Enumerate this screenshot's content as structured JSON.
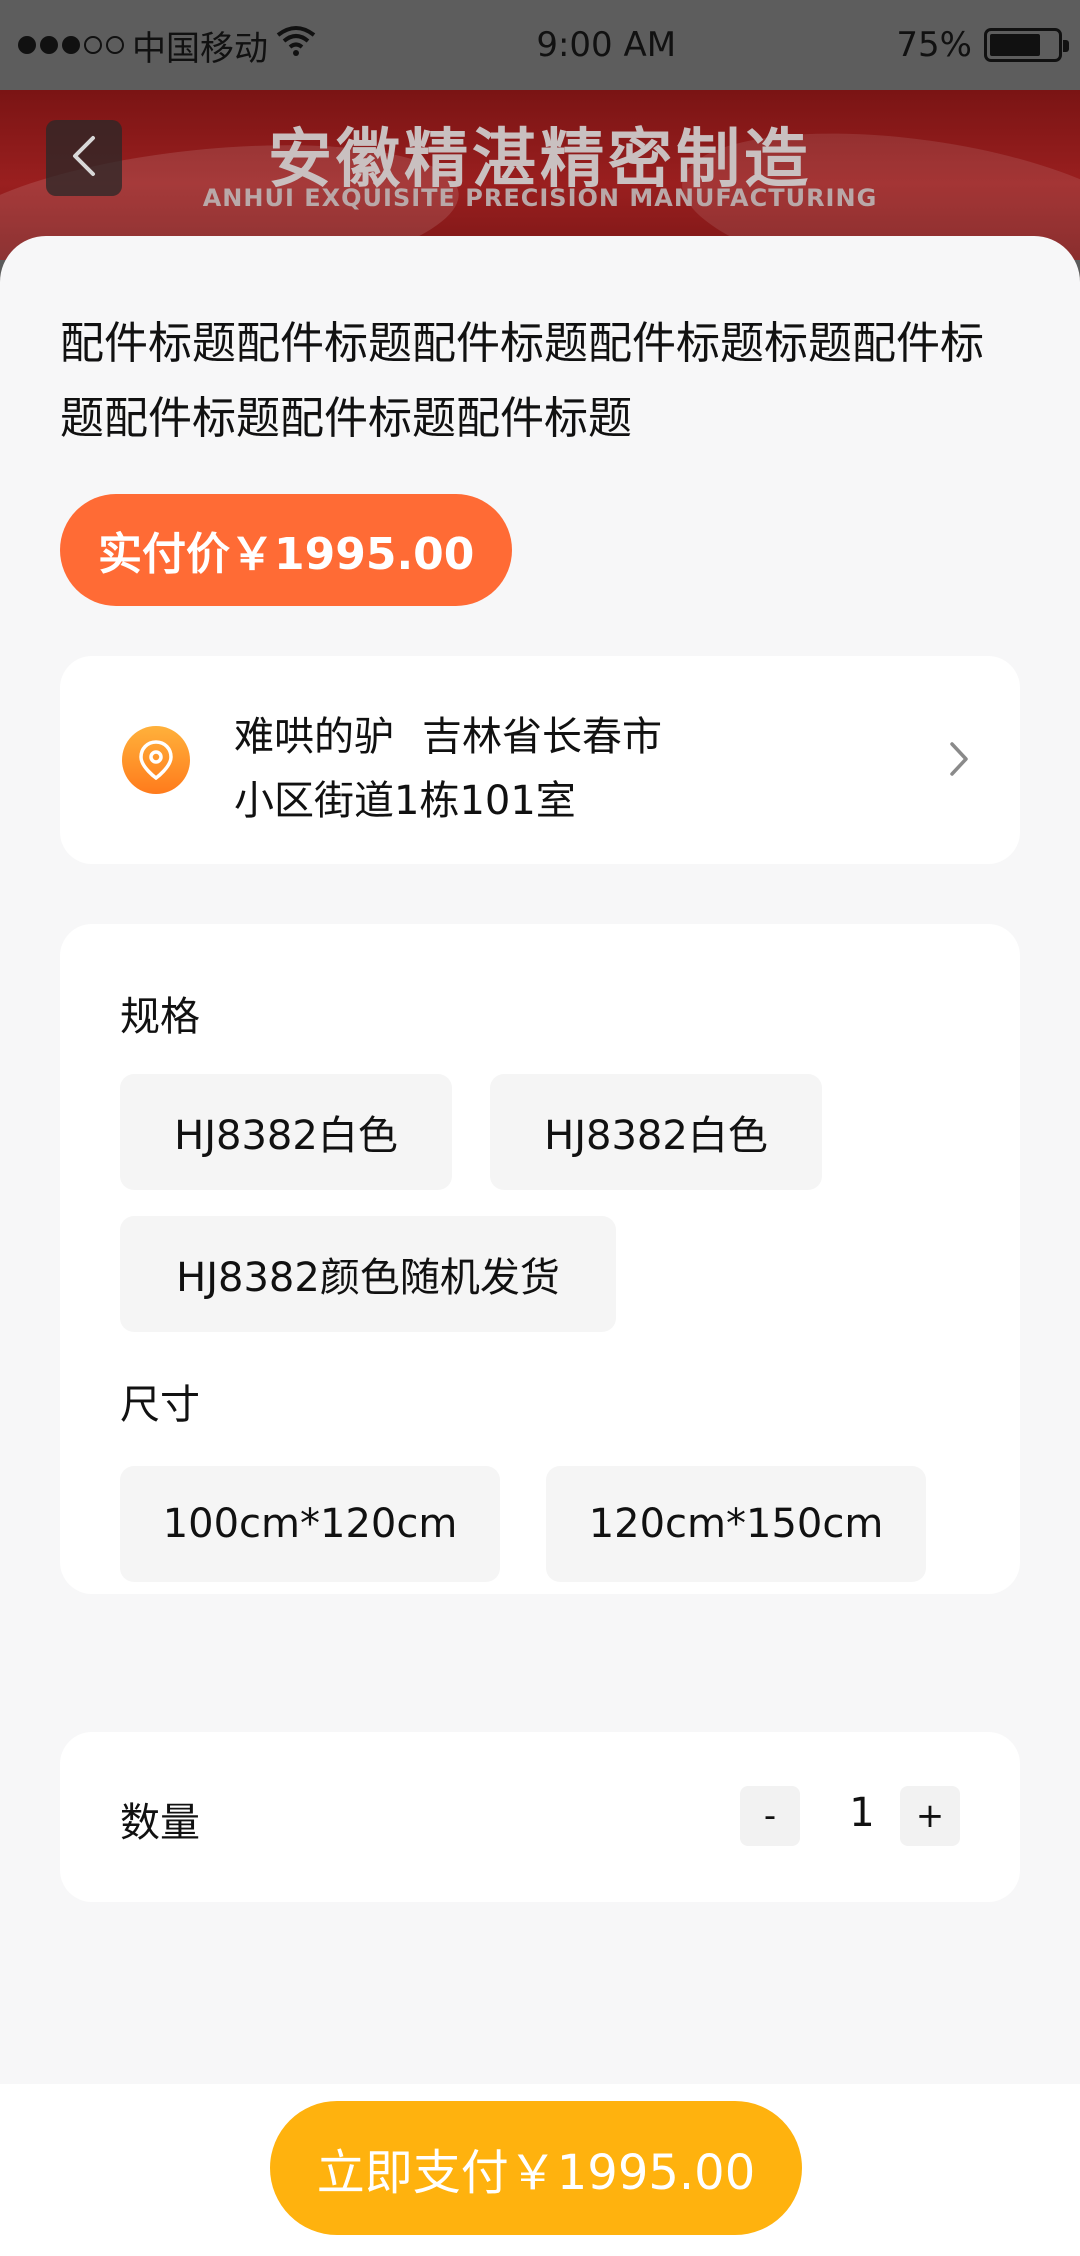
{
  "status_bar": {
    "carrier": "中国移动",
    "time": "9:00 AM",
    "battery": "75%",
    "battery_level": 0.75
  },
  "banner": {
    "title": "安徽精湛精密制造",
    "subtitle": "ANHUI EXQUISITE PRECISION MANUFACTURING"
  },
  "product": {
    "title": "配件标题配件标题配件标题配件标题标题配件标题配件标题配件标题配件标题",
    "price_pill": "实付价￥1995.00"
  },
  "address": {
    "name": "难哄的驴",
    "region": "吉林省长春市",
    "detail": "小区街道1栋101室"
  },
  "spec": {
    "label": "规格",
    "options": [
      "HJ8382白色",
      "HJ8382白色",
      "HJ8382颜色随机发货"
    ]
  },
  "size": {
    "label": "尺寸",
    "options": [
      "100cm*120cm",
      "120cm*150cm"
    ]
  },
  "quantity": {
    "label": "数量",
    "minus": "-",
    "value": "1",
    "plus": "+"
  },
  "footer": {
    "pay_button": "立即支付￥1995.00"
  },
  "colors": {
    "price_orange": "#ff6b35",
    "pay_yellow": "#ffb20e",
    "banner_red": "#9a1f1f",
    "chip_bg": "#f5f5f5"
  },
  "icons": [
    "back-icon",
    "wifi-icon",
    "location-icon",
    "chevron-right-icon"
  ]
}
